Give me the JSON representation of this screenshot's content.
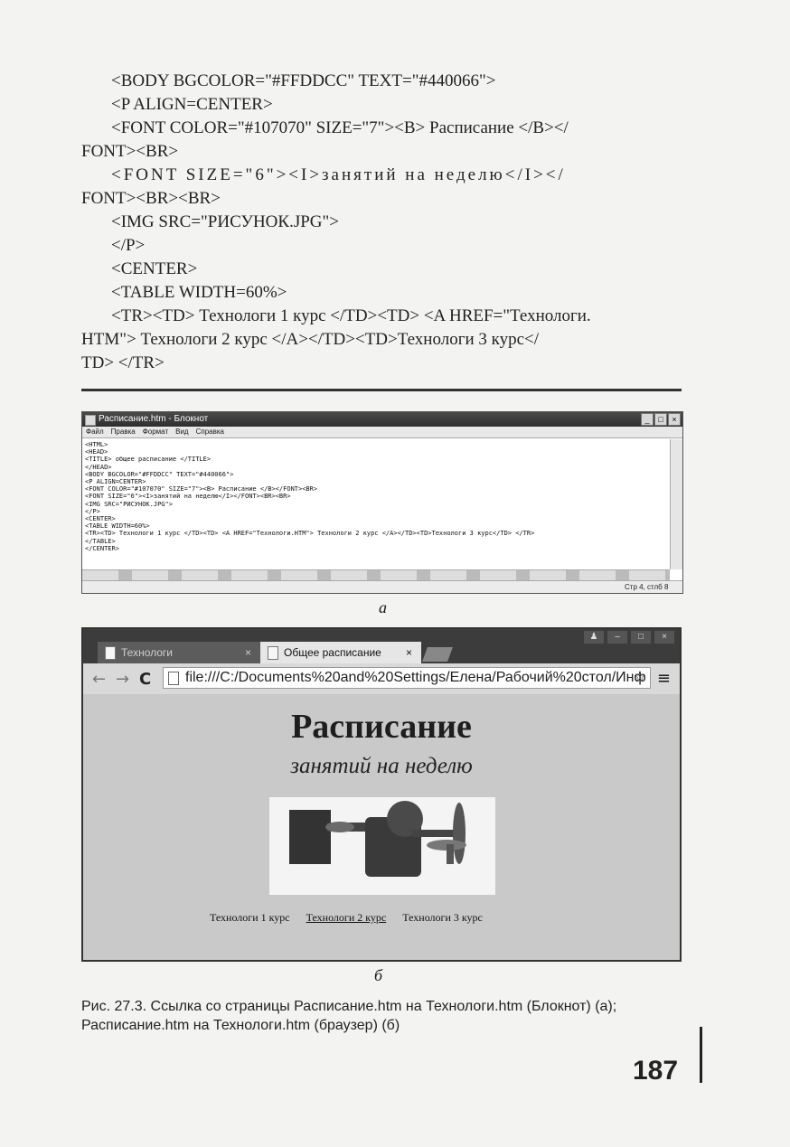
{
  "code_lines": [
    "<BODY BGCOLOR=\"#FFDDCC\" TEXT=\"#440066\">",
    "<P ALIGN=CENTER>",
    "<FONT COLOR=\"#107070\" SIZE=\"7\"><B> Расписание </B></",
    "FONT><BR>",
    "<FONT SIZE=\"6\"><I>занятий на неделю</I></",
    "FONT><BR><BR>",
    "<IMG SRC=\"РИСУНОК.JPG\">",
    "</P>",
    "<CENTER>",
    "<TABLE WIDTH=60%>",
    "<TR><TD> Технологи 1 курс </TD><TD> <A HREF=\"Технологи.",
    "HTM\"> Технологи 2 курс </A></TD><TD>Технологи 3 курс</",
    "TD> </TR>"
  ],
  "notepad": {
    "title": "Расписание.htm - Блокнот",
    "menu": [
      "Файл",
      "Правка",
      "Формат",
      "Вид",
      "Справка"
    ],
    "text": "<HTML>\n<HEAD>\n<TITLE> общее расписание </TITLE>\n</HEAD>\n<BODY BGCOLOR=\"#FFDDCC\" TEXT=\"#440066\">\n<P ALIGN=CENTER>\n<FONT COLOR=\"#107070\" SIZE=\"7\"><B> Расписание </B></FONT><BR>\n<FONT SIZE=\"6\"><I>занятий на неделю</I></FONT><BR><BR>\n<IMG SRC=\"РИСУНОК.JPG\">\n</P>\n<CENTER>\n<TABLE WIDTH=60%>\n<TR><TD> Технологи 1 курс </TD><TD> <A HREF=\"Технологи.HTM\"> Технологи 2 курс </A></TD><TD>Технологи 3 курс</TD> </TR>\n</TABLE>\n</CENTER>",
    "status": "Стр 4, стлб 8"
  },
  "label_a": "а",
  "label_b": "б",
  "browser": {
    "tab1": "Технологи",
    "tab2": "Общее расписание",
    "url": "file:///C:/Documents%20and%20Settings/Елена/Рабочий%20стол/Инф",
    "page_title": "Расписание",
    "page_subtitle": "занятий на неделю",
    "links": [
      "Технологи 1 курс",
      "Технологи 2 курс",
      "Технологи 3 курс"
    ]
  },
  "caption": "Рис. 27.3. Ссылка со страницы Расписание.htm на Технологи.htm (Блокнот) (а); Расписание.htm на Технологи.htm (браузер) (б)",
  "page_number": "187"
}
